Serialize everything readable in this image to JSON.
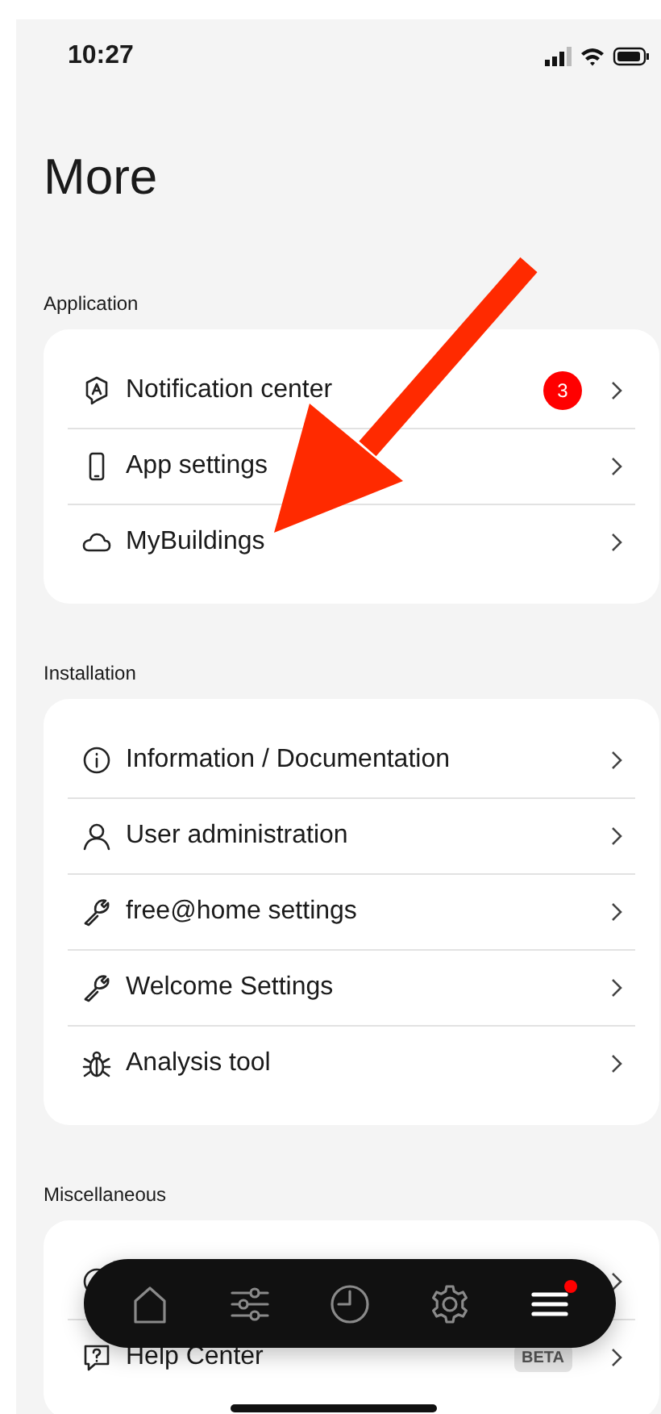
{
  "status_bar": {
    "time": "10:27"
  },
  "title": "More",
  "sections": [
    {
      "label": "Application",
      "items": [
        {
          "label": "Notification center",
          "badge": "3"
        },
        {
          "label": "App settings"
        },
        {
          "label": "MyBuildings"
        }
      ]
    },
    {
      "label": "Installation",
      "items": [
        {
          "label": "Information / Documentation"
        },
        {
          "label": "User administration"
        },
        {
          "label": "free@home settings"
        },
        {
          "label": "Welcome Settings"
        },
        {
          "label": "Analysis tool"
        }
      ]
    },
    {
      "label": "Miscellaneous",
      "items": [
        {
          "kind": "covered"
        },
        {
          "kind": "row",
          "label": "Help Center",
          "tag": "BETA"
        }
      ]
    }
  ],
  "nav": [
    {
      "selected": false,
      "dot": false
    },
    {
      "selected": false,
      "dot": false
    },
    {
      "selected": false,
      "dot": false
    },
    {
      "selected": false,
      "dot": false
    },
    {
      "selected": true,
      "dot": true
    }
  ],
  "annotation": {
    "kind": "arrow"
  }
}
